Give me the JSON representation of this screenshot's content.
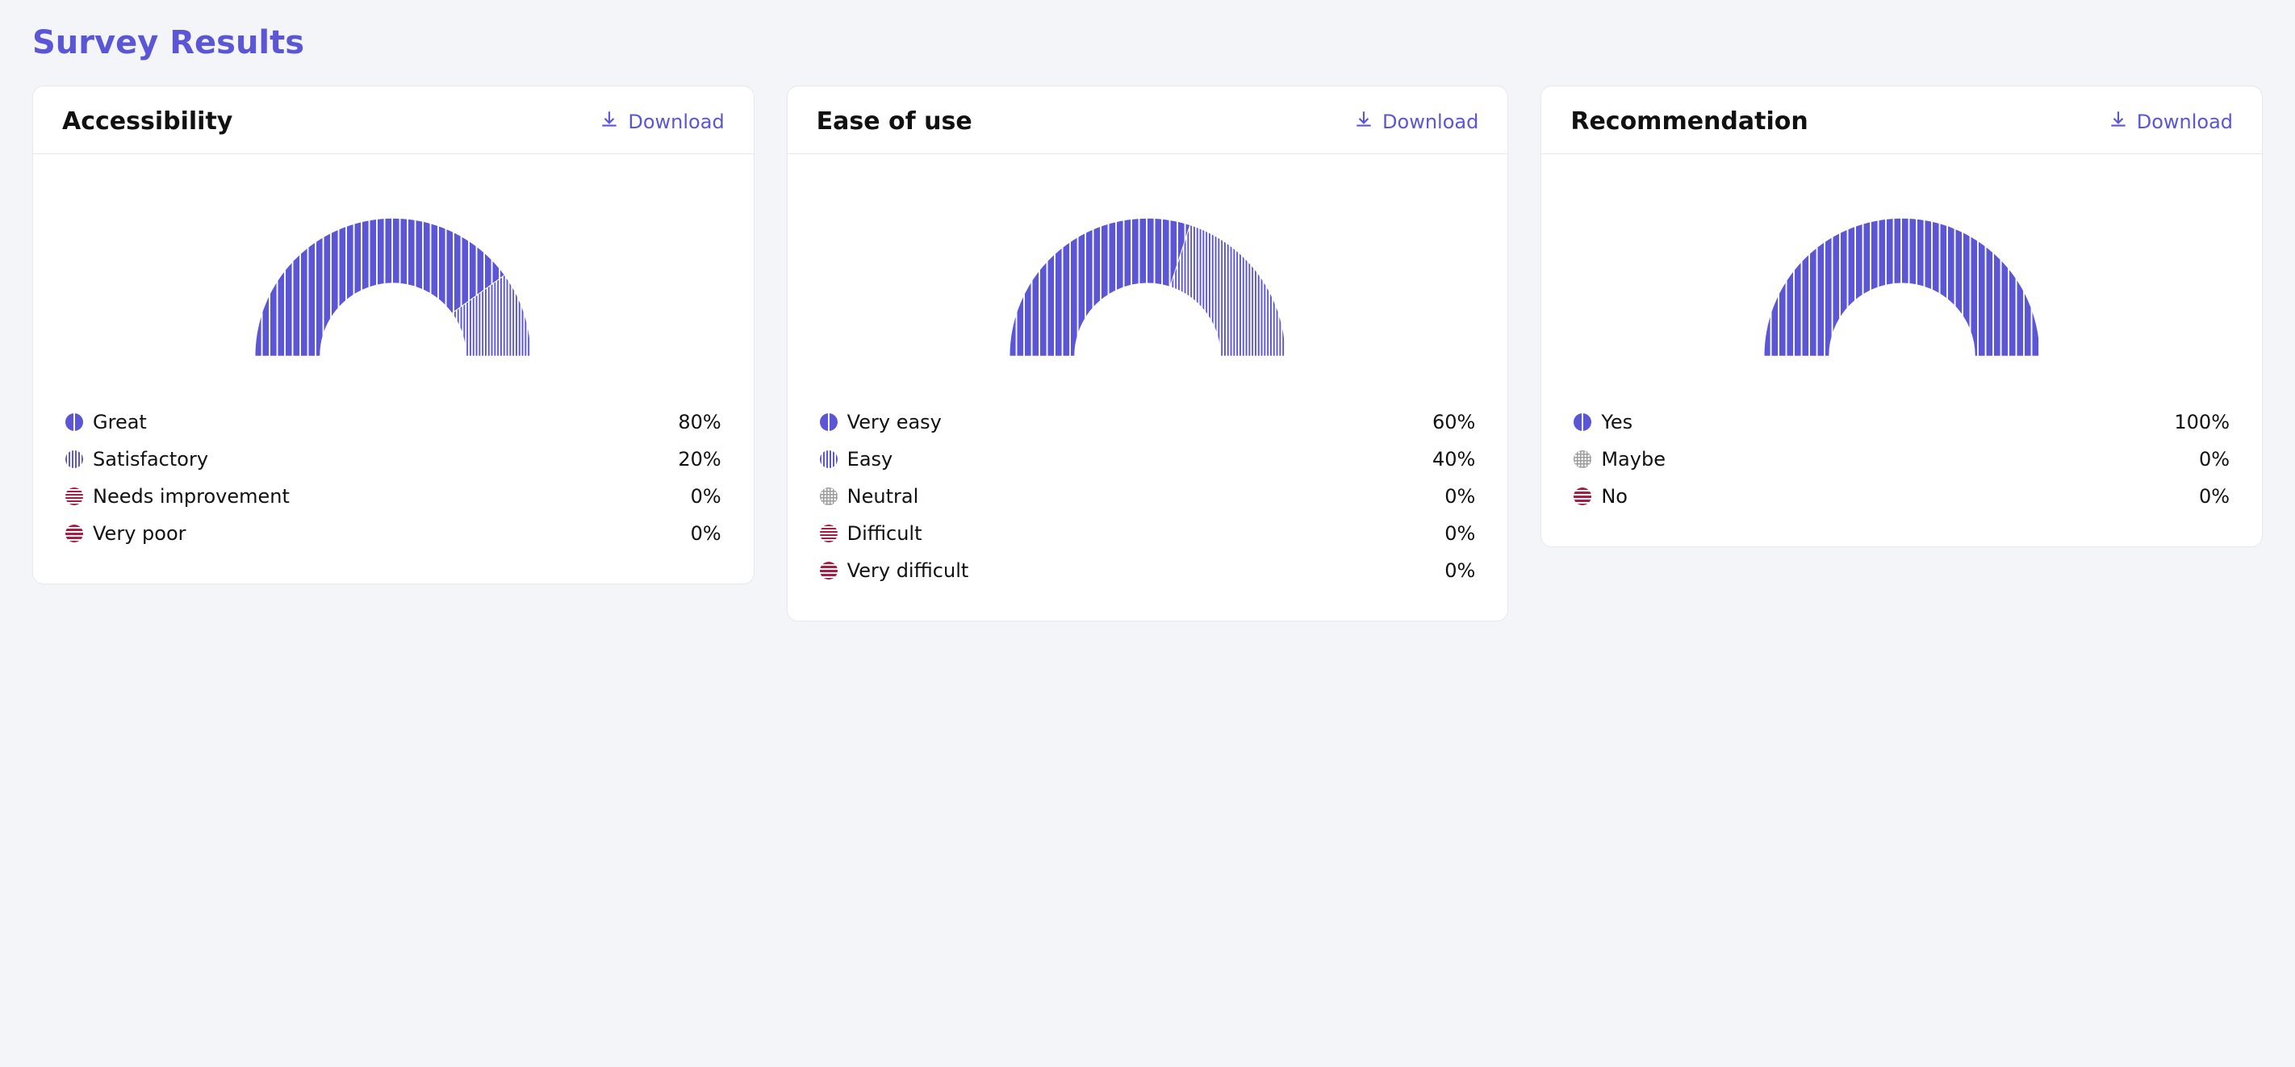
{
  "page": {
    "title": "Survey Results"
  },
  "labels": {
    "download": "Download"
  },
  "colors": {
    "accent": "#5b56d6",
    "crimson": "#a91d42",
    "grey": "#9b9b9b",
    "white": "#ffffff"
  },
  "cards": [
    {
      "id": "accessibility",
      "title": "Accessibility",
      "legend": [
        {
          "label": "Great",
          "value": "80%",
          "swatch": "solid-accent"
        },
        {
          "label": "Satisfactory",
          "value": "20%",
          "swatch": "v-accent"
        },
        {
          "label": "Needs improvement",
          "value": "0%",
          "swatch": "h-crimson"
        },
        {
          "label": "Very poor",
          "value": "0%",
          "swatch": "h-crimson-dark"
        }
      ]
    },
    {
      "id": "ease-of-use",
      "title": "Ease of use",
      "legend": [
        {
          "label": "Very easy",
          "value": "60%",
          "swatch": "solid-accent"
        },
        {
          "label": "Easy",
          "value": "40%",
          "swatch": "v-accent"
        },
        {
          "label": "Neutral",
          "value": "0%",
          "swatch": "grid-grey"
        },
        {
          "label": "Difficult",
          "value": "0%",
          "swatch": "h-crimson"
        },
        {
          "label": "Very difficult",
          "value": "0%",
          "swatch": "h-crimson-dark"
        }
      ]
    },
    {
      "id": "recommendation",
      "title": "Recommendation",
      "legend": [
        {
          "label": "Yes",
          "value": "100%",
          "swatch": "solid-accent"
        },
        {
          "label": "Maybe",
          "value": "0%",
          "swatch": "grid-grey"
        },
        {
          "label": "No",
          "value": "0%",
          "swatch": "h-crimson-dark"
        }
      ]
    }
  ],
  "chart_data": [
    {
      "type": "pie",
      "title": "Accessibility",
      "categories": [
        "Great",
        "Satisfactory",
        "Needs improvement",
        "Very poor"
      ],
      "values": [
        80,
        20,
        0,
        0
      ]
    },
    {
      "type": "pie",
      "title": "Ease of use",
      "categories": [
        "Very easy",
        "Easy",
        "Neutral",
        "Difficult",
        "Very difficult"
      ],
      "values": [
        60,
        40,
        0,
        0,
        0
      ]
    },
    {
      "type": "pie",
      "title": "Recommendation",
      "categories": [
        "Yes",
        "Maybe",
        "No"
      ],
      "values": [
        100,
        0,
        0
      ]
    }
  ]
}
